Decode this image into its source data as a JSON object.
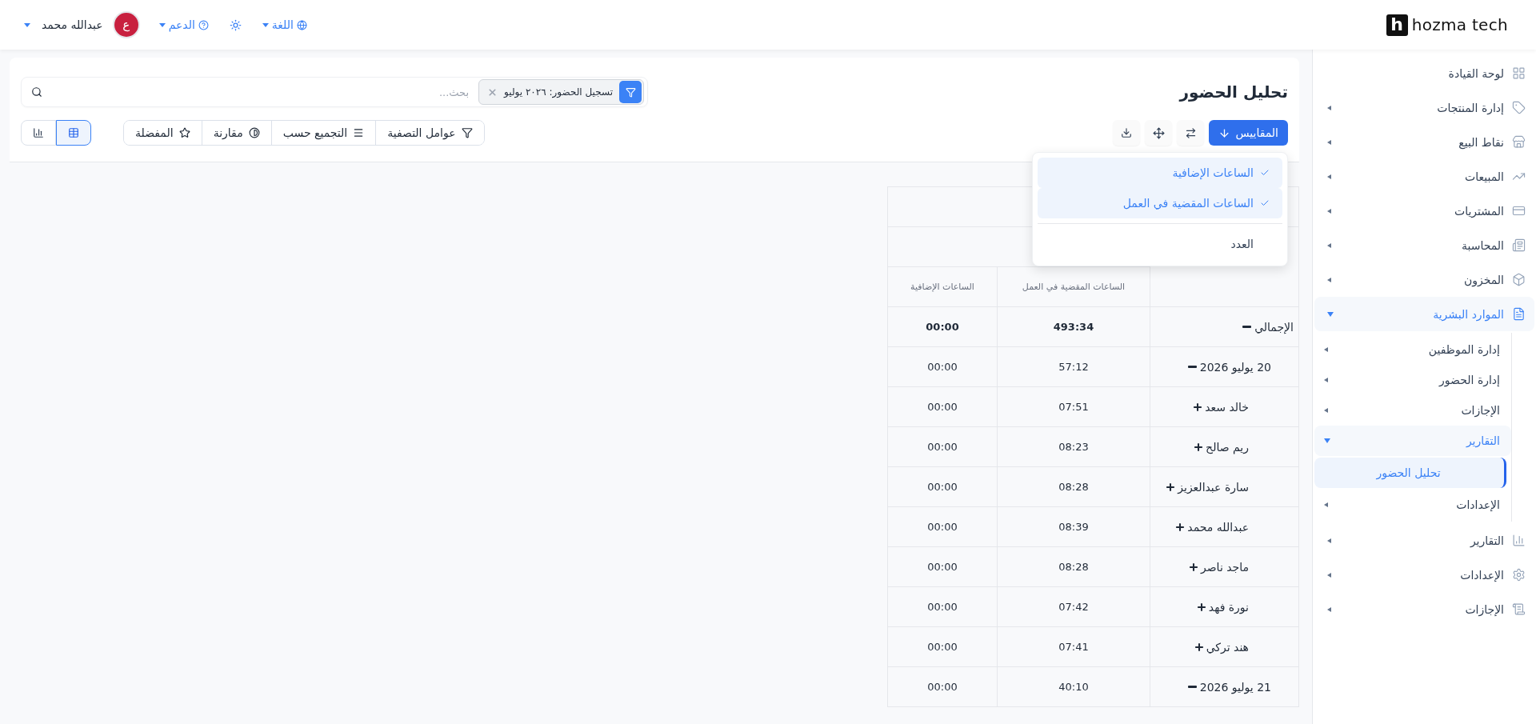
{
  "topbar": {
    "logo": {
      "mark": "h",
      "name": "hozma tech"
    },
    "language": "اللغة",
    "support": "الدعم",
    "user": {
      "initial": "ع",
      "name": "عبدالله محمد"
    }
  },
  "sidebar": {
    "items": [
      {
        "label": "لوحة القيادة",
        "kind": "link",
        "selected": false
      },
      {
        "label": "إدارة المنتجات",
        "kind": "group",
        "selected": false,
        "expanded": false
      },
      {
        "label": "نقاط البيع",
        "kind": "group",
        "selected": false,
        "expanded": false
      },
      {
        "label": "المبيعات",
        "kind": "group",
        "selected": false,
        "expanded": false
      },
      {
        "label": "المشتريات",
        "kind": "group",
        "selected": false,
        "expanded": false
      },
      {
        "label": "المحاسبة",
        "kind": "group",
        "selected": false,
        "expanded": false
      },
      {
        "label": "المخزون",
        "kind": "group",
        "selected": false,
        "expanded": false
      },
      {
        "label": "الموارد البشرية",
        "kind": "group",
        "selected": true,
        "expanded": true,
        "children": [
          {
            "label": "إدارة الموظفين",
            "kind": "group",
            "selected": false,
            "expanded": false
          },
          {
            "label": "إدارة الحضور",
            "kind": "group",
            "selected": false,
            "expanded": false
          },
          {
            "label": "الإجازات",
            "kind": "group",
            "selected": false,
            "expanded": false
          },
          {
            "label": "التقارير",
            "kind": "group",
            "selected": true,
            "expanded": true,
            "children": [
              {
                "label": "تحليل الحضور",
                "kind": "link",
                "selected": true
              }
            ]
          },
          {
            "label": "الإعدادات",
            "kind": "group",
            "selected": false,
            "expanded": false
          }
        ]
      },
      {
        "label": "التقارير",
        "kind": "group",
        "selected": false,
        "expanded": false
      },
      {
        "label": "الإعدادات",
        "kind": "group",
        "selected": false,
        "expanded": false
      },
      {
        "label": "الإجازات",
        "kind": "group",
        "selected": false,
        "expanded": false
      }
    ]
  },
  "page": {
    "title": "تحليل الحضور",
    "search": {
      "facet": "تسجيل الحضور: ٢٠٢٦ يوليو",
      "placeholder": "بحث..."
    },
    "measures_button": "المقاييس",
    "measures_menu": {
      "sections": [
        {
          "items": [
            {
              "label": "الساعات الإضافية",
              "checked": true
            },
            {
              "label": "الساعات المقضية في العمل",
              "checked": true
            }
          ]
        },
        {
          "items": [
            {
              "label": "العدد",
              "checked": false
            }
          ]
        }
      ]
    },
    "filter_bar": [
      "عوامل التصفية",
      "التجميع حسب",
      "مقارنة",
      "المفضلة"
    ],
    "views": [
      {
        "kind": "table",
        "selected": true
      },
      {
        "kind": "chart",
        "selected": false
      }
    ]
  },
  "table": {
    "columns": [
      "الساعات المقضية في العمل",
      "الساعات الإضافية"
    ],
    "rows": [
      {
        "label": "الإجمالي",
        "expanded": true,
        "values": [
          "493:34",
          "00:00"
        ],
        "children": [
          {
            "label": "20 يوليو 2026",
            "expanded": true,
            "values": [
              "57:12",
              "00:00"
            ],
            "children": [
              {
                "label": "خالد سعد",
                "expanded": false,
                "values": [
                  "07:51",
                  "00:00"
                ]
              },
              {
                "label": "ريم صالح",
                "expanded": false,
                "values": [
                  "08:23",
                  "00:00"
                ]
              },
              {
                "label": "سارة عبدالعزيز",
                "expanded": false,
                "values": [
                  "08:28",
                  "00:00"
                ]
              },
              {
                "label": "عبدالله محمد",
                "expanded": false,
                "values": [
                  "08:39",
                  "00:00"
                ]
              },
              {
                "label": "ماجد ناصر",
                "expanded": false,
                "values": [
                  "08:28",
                  "00:00"
                ]
              },
              {
                "label": "نورة فهد",
                "expanded": false,
                "values": [
                  "07:42",
                  "00:00"
                ]
              },
              {
                "label": "هند تركي",
                "expanded": false,
                "values": [
                  "07:41",
                  "00:00"
                ]
              }
            ]
          },
          {
            "label": "21 يوليو 2026",
            "expanded": true,
            "values": [
              "40:10",
              "00:00"
            ]
          }
        ]
      }
    ]
  }
}
